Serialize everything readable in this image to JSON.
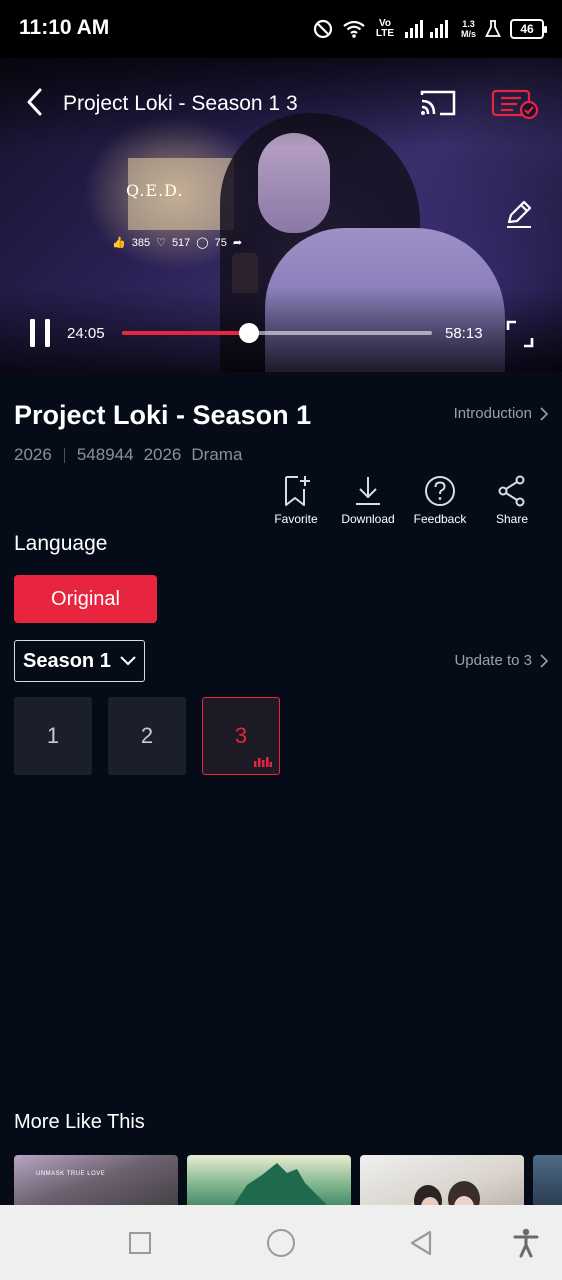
{
  "status_bar": {
    "time": "11:10 AM",
    "network_label": "Vo LTE",
    "speed_value": "1.3",
    "speed_unit": "M/s",
    "battery": "46"
  },
  "player": {
    "title": "Project Loki - Season 1 3",
    "current_time": "24:05",
    "duration": "58:13",
    "progress": 0.41,
    "accent_color": "#e8253e",
    "in_video_text": {
      "logo": "Q.E.D.",
      "likes": "385",
      "hearts": "517",
      "comments": "75"
    }
  },
  "details": {
    "title": "Project Loki - Season 1",
    "introduction_label": "Introduction",
    "meta": {
      "year": "2026",
      "views": "548944",
      "year2": "2026",
      "genre": "Drama"
    },
    "actions": [
      {
        "label": "Favorite",
        "icon": "bookmark-plus-icon"
      },
      {
        "label": "Download",
        "icon": "download-icon"
      },
      {
        "label": "Feedback",
        "icon": "help-circle-icon"
      },
      {
        "label": "Share",
        "icon": "share-icon"
      }
    ]
  },
  "language": {
    "title": "Language",
    "selected": "Original"
  },
  "season": {
    "selected": "Season 1",
    "update_label": "Update to 3"
  },
  "episodes": [
    {
      "number": "1",
      "active": false
    },
    {
      "number": "2",
      "active": false
    },
    {
      "number": "3",
      "active": true
    }
  ],
  "more_like_this": {
    "title": "More Like This",
    "thumbnails": [
      {
        "caption": "UNMASK TRUE LOVE"
      },
      {
        "caption": ""
      },
      {
        "caption": ""
      },
      {
        "caption": ""
      }
    ]
  },
  "nav_bar": {
    "icons": [
      "recents-square-icon",
      "home-circle-icon",
      "back-triangle-icon",
      "accessibility-icon"
    ]
  }
}
